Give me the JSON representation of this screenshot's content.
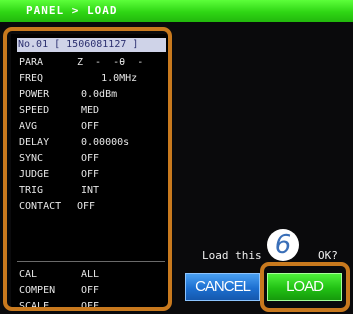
{
  "title_bar": {
    "title": "PANEL > LOAD"
  },
  "panel": {
    "header": "No.01 [ 1506081127 ]",
    "rows": [
      {
        "label": "PARA",
        "value": "Z  -  -θ  -"
      },
      {
        "label": "FREQ",
        "value": "    1.0MHz"
      },
      {
        "label": "POWER",
        "value": "0.0dBm"
      },
      {
        "label": "SPEED",
        "value": "MED"
      },
      {
        "label": "AVG",
        "value": "OFF"
      },
      {
        "label": "DELAY",
        "value": "0.00000s"
      },
      {
        "label": "SYNC",
        "value": "OFF"
      },
      {
        "label": "JUDGE",
        "value": "OFF"
      },
      {
        "label": "TRIG",
        "value": "INT"
      },
      {
        "label": "CONTACT",
        "value": "OFF"
      },
      {
        "label": "CAL",
        "value": "ALL"
      },
      {
        "label": "COMPEN",
        "value": "OFF"
      },
      {
        "label": "SCALE",
        "value": "OFF"
      }
    ]
  },
  "prompt": {
    "text": "Load this",
    "tail": "OK?"
  },
  "step_badge": "6",
  "buttons": {
    "cancel": "CANCEL",
    "load": "LOAD"
  },
  "colors": {
    "title_bar": "#2fd614",
    "highlight_frame": "#c8791e",
    "cancel_button": "#1c6fd0",
    "load_button": "#21c114",
    "header_bg": "#cfd3e8",
    "header_text": "#2d3170"
  }
}
